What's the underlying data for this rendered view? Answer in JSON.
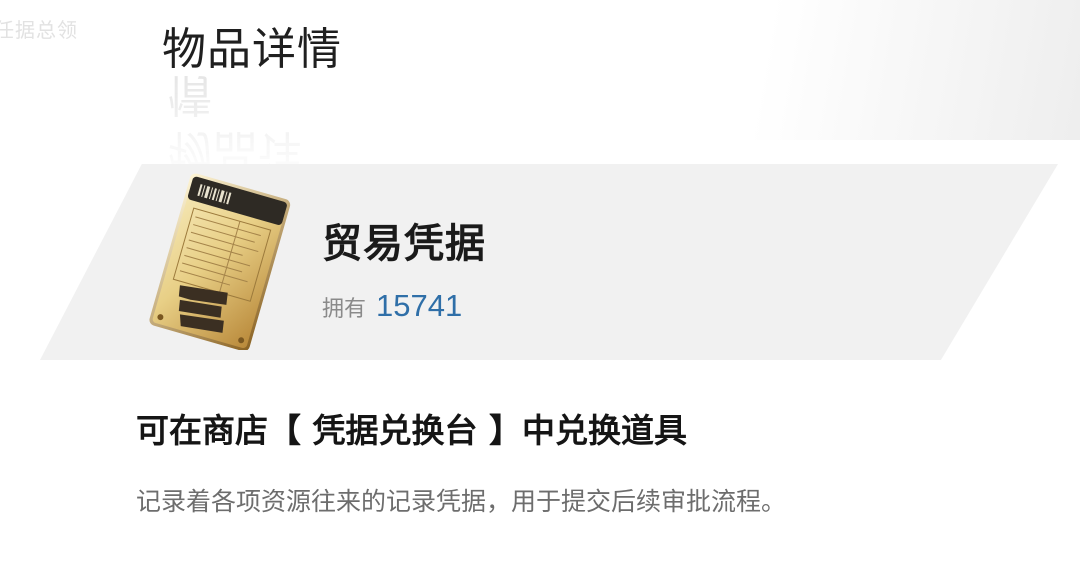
{
  "header": {
    "title": "物品详情",
    "corner_text": "任据总领"
  },
  "item": {
    "name": "贸易凭据",
    "owned_label": "拥有",
    "owned_count": "15741",
    "icon": "trade-voucher-card-icon",
    "count_color": "#2f6fa8"
  },
  "details": {
    "exchange_note": "可在商店【 凭据兑换台 】中兑换道具",
    "description": "记录着各项资源往来的记录凭据，用于提交后续审批流程。"
  }
}
